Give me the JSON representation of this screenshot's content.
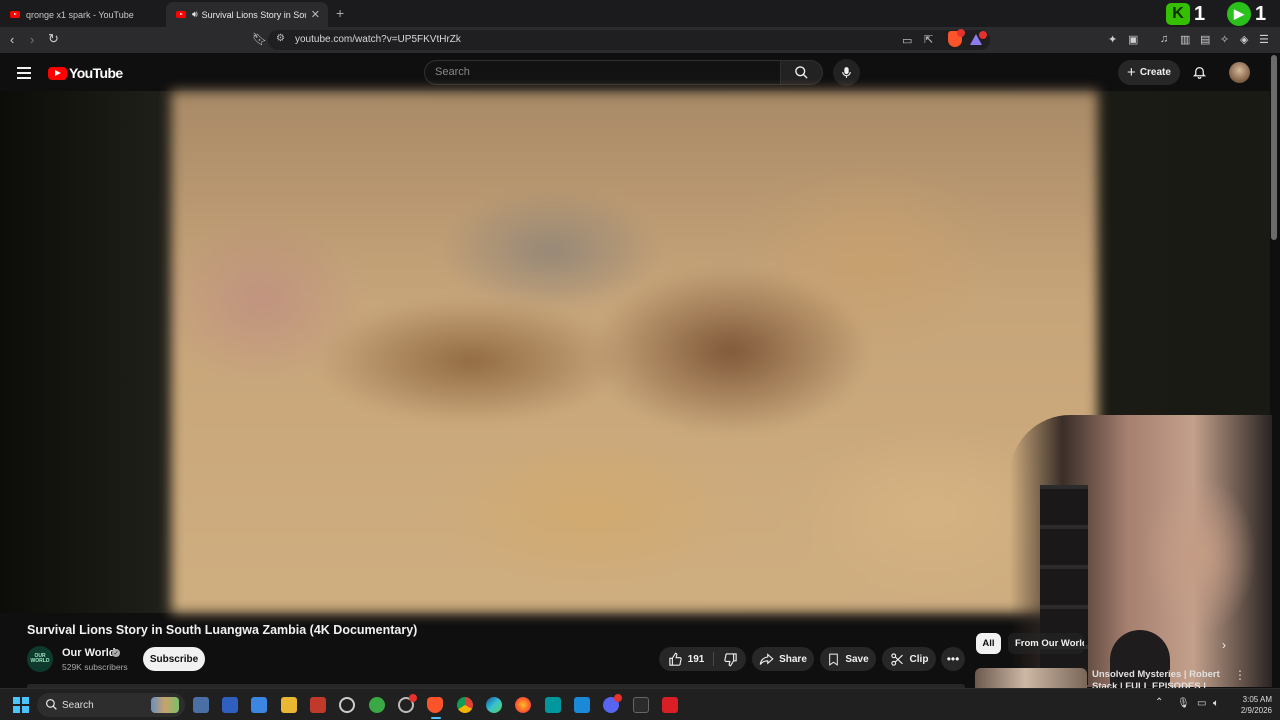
{
  "browser": {
    "tabs": [
      {
        "title": "qronge x1 spark - YouTube",
        "active": false
      },
      {
        "title": "Survival Lions Story in South L",
        "active": true,
        "audio": true
      }
    ],
    "new_tab": "+",
    "close": "✕",
    "extension_counts": [
      "1",
      "1"
    ],
    "url": "youtube.com/watch?v=UP5FKVtHrZk"
  },
  "youtube": {
    "logo_text": "YouTube",
    "search_placeholder": "Search",
    "create_label": "Create"
  },
  "video": {
    "title": "Survival Lions Story in South Luangwa Zambia (4K Documentary)",
    "channel": {
      "name": "Our World",
      "avatar_text": "OUR WORLD",
      "subscribers": "529K subscribers",
      "verified": true
    },
    "subscribe_label": "Subscribe",
    "likes": "191",
    "share_label": "Share",
    "save_label": "Save",
    "clip_label": "Clip",
    "more_label": "•••"
  },
  "sidebar": {
    "chips": [
      "All",
      "From Our World"
    ],
    "recommended": [
      {
        "title": "Unsolved Mysteries | Robert Stack | FULL EPISODES |"
      }
    ]
  },
  "taskbar": {
    "search_label": "Search",
    "time": "3:05 AM",
    "date": "2/9/2026"
  },
  "colors": {
    "yt_red": "#ff0000",
    "background": "#0f0f0f",
    "accent_blue": "#4cc2ff"
  }
}
